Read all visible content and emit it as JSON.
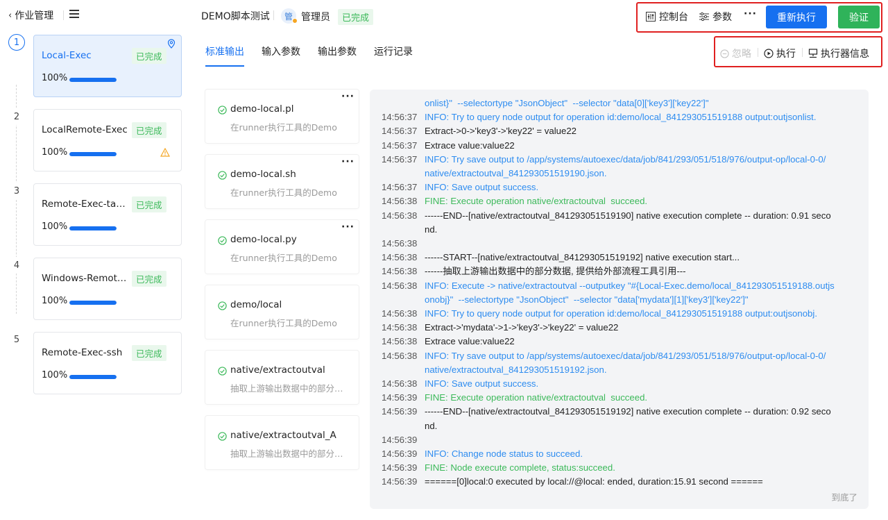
{
  "header": {
    "back_label": "作业管理",
    "script_title": "DEMO脚本测试",
    "avatar_char": "管",
    "role": "管理员",
    "status": "已完成",
    "toolbar": {
      "console": "控制台",
      "params": "参数",
      "more": "···",
      "rerun": "重新执行",
      "verify": "验证"
    }
  },
  "steps": [
    {
      "num": "1",
      "name": "Local-Exec",
      "status": "已完成",
      "percent": "100%",
      "progress": 1.0,
      "active": true
    },
    {
      "num": "2",
      "name": "LocalRemote-Exec",
      "status": "已完成",
      "percent": "100%",
      "progress": 1.0,
      "warning": true
    },
    {
      "num": "3",
      "name": "Remote-Exec-tagent",
      "status": "已完成",
      "percent": "100%",
      "progress": 1.0
    },
    {
      "num": "4",
      "name": "Windows-Remote-Exec",
      "status": "已完成",
      "percent": "100%",
      "progress": 1.0
    },
    {
      "num": "5",
      "name": "Remote-Exec-ssh",
      "status": "已完成",
      "percent": "100%",
      "progress": 1.0
    }
  ],
  "tabs": [
    "标准输出",
    "输入参数",
    "输出参数",
    "运行记录"
  ],
  "sub_toolbar": {
    "ignore": "忽略",
    "execute": "执行",
    "executor_info": "执行器信息"
  },
  "tools": [
    {
      "name": "demo-local.pl",
      "desc": "在runner执行工具的Demo",
      "has_more": true
    },
    {
      "name": "demo-local.sh",
      "desc": "在runner执行工具的Demo",
      "has_more": true
    },
    {
      "name": "demo-local.py",
      "desc": "在runner执行工具的Demo",
      "has_more": true
    },
    {
      "name": "demo/local",
      "desc": "在runner执行工具的Demo",
      "has_more": false
    },
    {
      "name": "native/extractoutval",
      "desc": "抽取上游输出数据中的部分数据，提供给外部流程工具引用",
      "has_more": false
    },
    {
      "name": "native/extractoutval_A",
      "desc": "抽取上游输出数据中的部分数据，提供给外部流程工具引用",
      "has_more": false
    }
  ],
  "log": [
    {
      "ts": "",
      "type": "info",
      "msg": "onlist}\"  --selectortype \"JsonObject\"  --selector \"data[0]['key3']['key22']\""
    },
    {
      "ts": "14:56:37",
      "type": "info",
      "msg": "INFO: Try to query node output for operation id:demo/local_841293051519188 output:outjsonlist."
    },
    {
      "ts": "14:56:37",
      "type": "plain",
      "msg": "Extract->0->'key3'->'key22' = value22"
    },
    {
      "ts": "14:56:37",
      "type": "plain",
      "msg": "Extrace value:value22"
    },
    {
      "ts": "14:56:37",
      "type": "info",
      "msg": "INFO: Try save output to /app/systems/autoexec/data/job/841/293/051/518/976/output-op/local-0-0/\nnative/extractoutval_841293051519190.json."
    },
    {
      "ts": "14:56:37",
      "type": "info",
      "msg": "INFO: Save output success."
    },
    {
      "ts": "14:56:38",
      "type": "fine",
      "msg": "FINE: Execute operation native/extractoutval  succeed."
    },
    {
      "ts": "14:56:38",
      "type": "plain",
      "msg": "------END--[native/extractoutval_841293051519190] native execution complete -- duration: 0.91 seco\nnd."
    },
    {
      "ts": "14:56:38",
      "type": "plain",
      "msg": ""
    },
    {
      "ts": "14:56:38",
      "type": "plain",
      "msg": "------START--[native/extractoutval_841293051519192] native execution start..."
    },
    {
      "ts": "14:56:38",
      "type": "plain",
      "msg": "------抽取上游输出数据中的部分数据, 提供给外部流程工具引用---"
    },
    {
      "ts": "14:56:38",
      "type": "info",
      "msg": "INFO: Execute -> native/extractoutval --outputkey \"#{Local-Exec.demo/local_841293051519188.outjs\nonobj}\"  --selectortype \"JsonObject\"  --selector \"data['mydata'][1]['key3']['key22']\""
    },
    {
      "ts": "14:56:38",
      "type": "info",
      "msg": "INFO: Try to query node output for operation id:demo/local_841293051519188 output:outjsonobj."
    },
    {
      "ts": "14:56:38",
      "type": "plain",
      "msg": "Extract->'mydata'->1->'key3'->'key22' = value22"
    },
    {
      "ts": "14:56:38",
      "type": "plain",
      "msg": "Extrace value:value22"
    },
    {
      "ts": "14:56:38",
      "type": "info",
      "msg": "INFO: Try save output to /app/systems/autoexec/data/job/841/293/051/518/976/output-op/local-0-0/\nnative/extractoutval_841293051519192.json."
    },
    {
      "ts": "14:56:38",
      "type": "info",
      "msg": "INFO: Save output success."
    },
    {
      "ts": "14:56:39",
      "type": "fine",
      "msg": "FINE: Execute operation native/extractoutval  succeed."
    },
    {
      "ts": "14:56:39",
      "type": "plain",
      "msg": "------END--[native/extractoutval_841293051519192] native execution complete -- duration: 0.92 seco\nnd."
    },
    {
      "ts": "14:56:39",
      "type": "plain",
      "msg": ""
    },
    {
      "ts": "14:56:39",
      "type": "info",
      "msg": "INFO: Change node status to succeed."
    },
    {
      "ts": "14:56:39",
      "type": "fine",
      "msg": "FINE: Node execute complete, status:succeed."
    },
    {
      "ts": "14:56:39",
      "type": "plain",
      "msg": "======[0]local:0 executed by local://@local: ended, duration:15.91 second ======"
    }
  ],
  "log_end": "到底了",
  "colors": {
    "primary": "#1670f0",
    "success": "#2fb35a",
    "info": "#2d8cf0",
    "fine": "#3cb95a",
    "highlight_box": "#e02020"
  }
}
